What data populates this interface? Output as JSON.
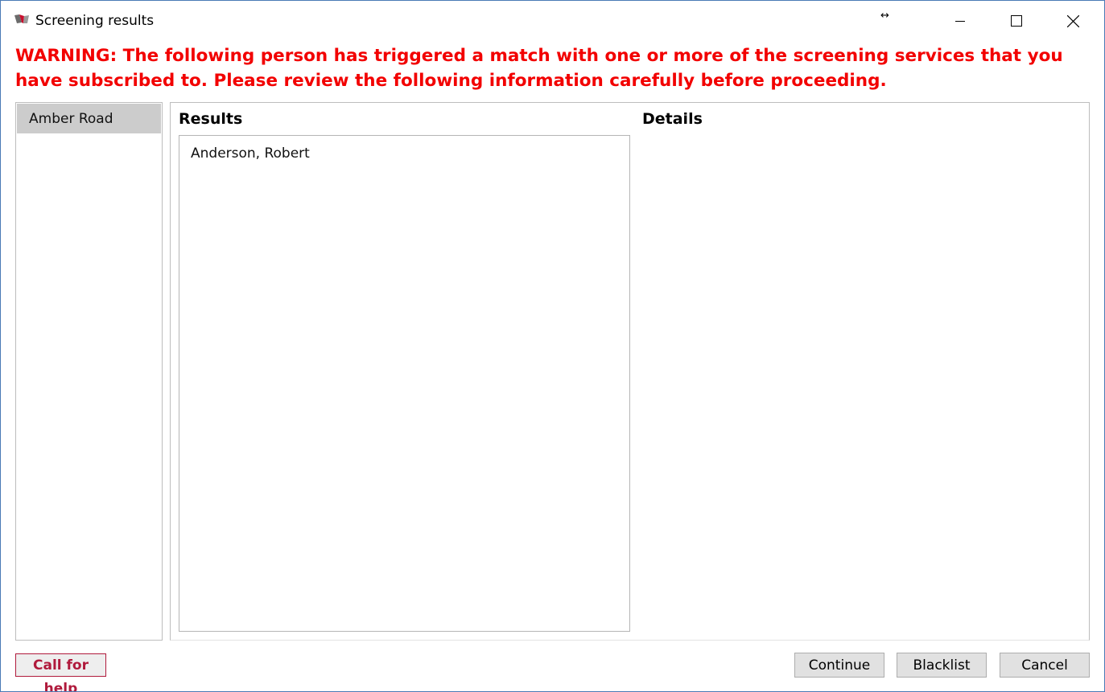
{
  "window": {
    "title": "Screening results",
    "resize_indicator": "↔"
  },
  "warning": {
    "text": "WARNING: The following person has triggered a match with one or more of the screening services that you have subscribed to. Please review the following information carefully before proceeding."
  },
  "providers": [
    {
      "label": "Amber Road",
      "selected": true
    }
  ],
  "results": {
    "header": "Results",
    "items": [
      "Anderson, Robert"
    ]
  },
  "details": {
    "header": "Details"
  },
  "footer": {
    "help_label": "Call for help",
    "continue_label": "Continue",
    "blacklist_label": "Blacklist",
    "cancel_label": "Cancel"
  },
  "colors": {
    "warning": "#f20000",
    "help": "#b01a3c",
    "selected_item": "#cccccc",
    "window_border": "#4a7ab5"
  }
}
